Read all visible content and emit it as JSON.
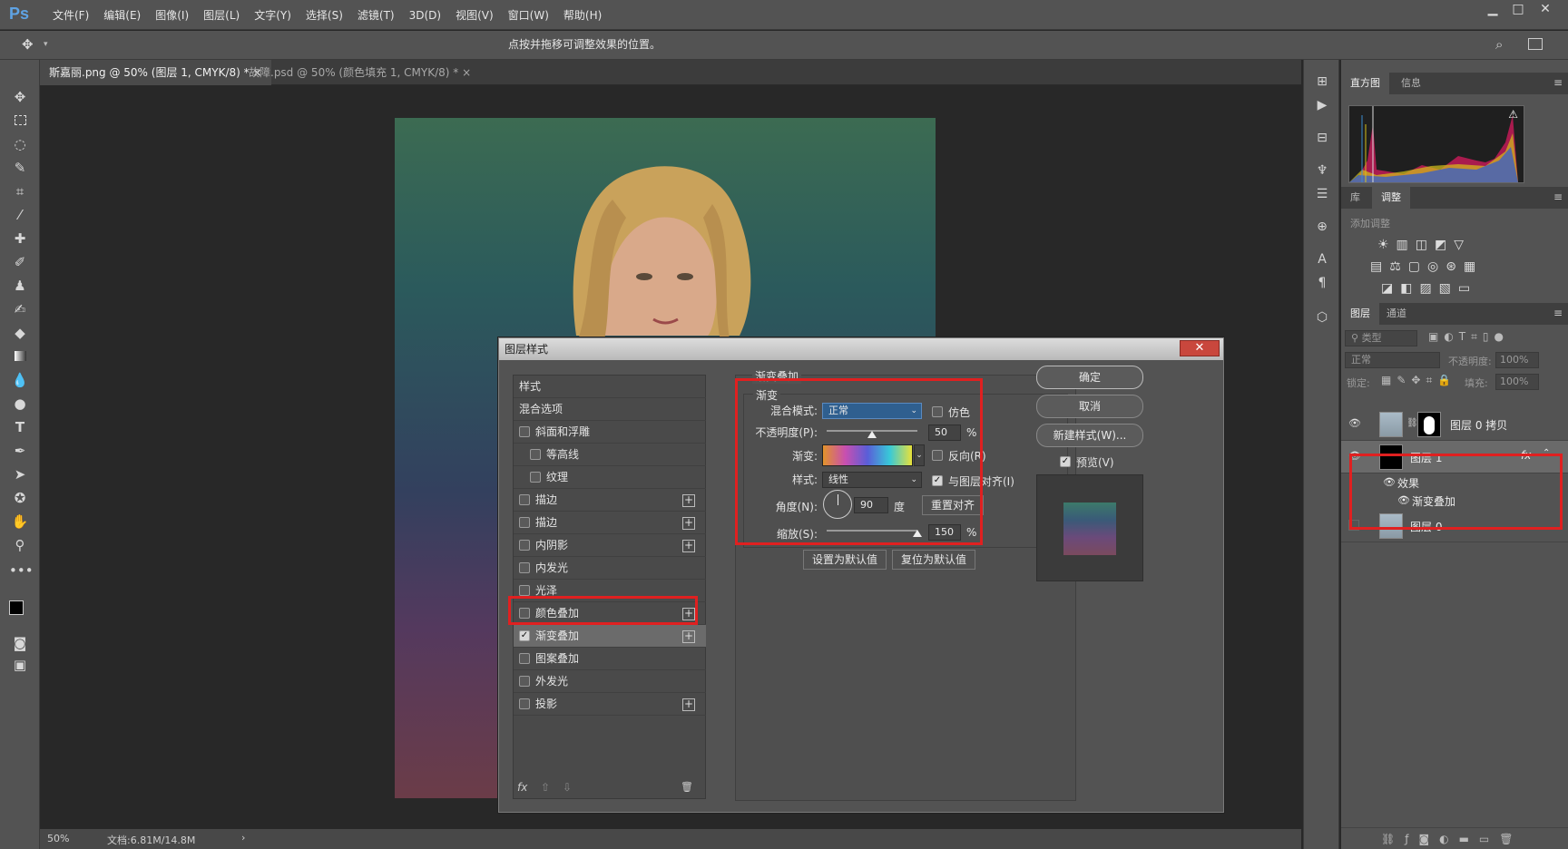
{
  "app": {
    "logo": "Ps"
  },
  "menu": [
    "文件(F)",
    "编辑(E)",
    "图像(I)",
    "图层(L)",
    "文字(Y)",
    "选择(S)",
    "滤镜(T)",
    "3D(D)",
    "视图(V)",
    "窗口(W)",
    "帮助(H)"
  ],
  "window_controls": {
    "minimize": "▁",
    "restore": "□",
    "close": "✕"
  },
  "options": {
    "hint": "点按并拖移可调整效果的位置。"
  },
  "doc_tabs": [
    {
      "label": "斯嘉丽.png @ 50% (图层 1, CMYK/8) *",
      "close": "×"
    },
    {
      "label": "故障.psd @ 50% (颜色填充 1, CMYK/8) *",
      "close": "×"
    }
  ],
  "status": {
    "zoom": "50%",
    "doc": "文档:6.81M/14.8M",
    "arrow": "›"
  },
  "panels": {
    "top_tabs": [
      "直方图",
      "信息"
    ],
    "mid_tabs": [
      "库",
      "调整"
    ],
    "adjust_hint": "添加调整",
    "layer_tabs": [
      "图层",
      "通道"
    ],
    "filter_label": "类型",
    "blend_mode": "正常",
    "opacity_label": "不透明度:",
    "opacity_value": "100%",
    "lock_label": "锁定:",
    "fill_label": "填充:",
    "fill_value": "100%",
    "layers": [
      {
        "name": "图层 0 拷贝"
      },
      {
        "name": "图层 1",
        "fx": "fx",
        "effects_label": "效果",
        "effect_item": "渐变叠加"
      },
      {
        "name": "图层 0"
      }
    ]
  },
  "dialog": {
    "title": "图层样式",
    "close": "✕",
    "list_header": "样式",
    "styles": [
      {
        "label": "混合选项",
        "checkbox": false,
        "plus": false,
        "checked": false
      },
      {
        "label": "斜面和浮雕",
        "checkbox": true,
        "plus": false,
        "checked": false
      },
      {
        "label": "等高线",
        "checkbox": true,
        "plus": false,
        "checked": false,
        "indent": true
      },
      {
        "label": "纹理",
        "checkbox": true,
        "plus": false,
        "checked": false,
        "indent": true
      },
      {
        "label": "描边",
        "checkbox": true,
        "plus": true,
        "checked": false
      },
      {
        "label": "描边",
        "checkbox": true,
        "plus": true,
        "checked": false
      },
      {
        "label": "内阴影",
        "checkbox": true,
        "plus": true,
        "checked": false
      },
      {
        "label": "内发光",
        "checkbox": true,
        "plus": false,
        "checked": false
      },
      {
        "label": "光泽",
        "checkbox": true,
        "plus": false,
        "checked": false
      },
      {
        "label": "颜色叠加",
        "checkbox": true,
        "plus": true,
        "checked": false
      },
      {
        "label": "渐变叠加",
        "checkbox": true,
        "plus": true,
        "checked": true
      },
      {
        "label": "图案叠加",
        "checkbox": true,
        "plus": false,
        "checked": false
      },
      {
        "label": "外发光",
        "checkbox": true,
        "plus": false,
        "checked": false
      },
      {
        "label": "投影",
        "checkbox": true,
        "plus": true,
        "checked": false
      }
    ],
    "footer_icons": {
      "fx": "fx",
      "up": "⇧",
      "down": "⇩",
      "trash": "🗑"
    },
    "section_title": "渐变叠加",
    "group_title": "渐变",
    "blend_label": "混合模式:",
    "blend_value": "正常",
    "dither_label": "仿色",
    "opacity_label": "不透明度(P):",
    "opacity_value": "50",
    "opacity_unit": "%",
    "gradient_label": "渐变:",
    "reverse_label": "反向(R)",
    "style_label": "样式:",
    "style_value": "线性",
    "align_label": "与图层对齐(I)",
    "angle_label": "角度(N):",
    "angle_value": "90",
    "angle_unit": "度",
    "reset_align": "重置对齐",
    "scale_label": "缩放(S):",
    "scale_value": "150",
    "scale_unit": "%",
    "set_default": "设置为默认值",
    "reset_default": "复位为默认值",
    "ok": "确定",
    "cancel": "取消",
    "new_style": "新建样式(W)...",
    "preview_label": "预览(V)",
    "opacity_fraction": 0.5,
    "scale_fraction": 1.0
  }
}
